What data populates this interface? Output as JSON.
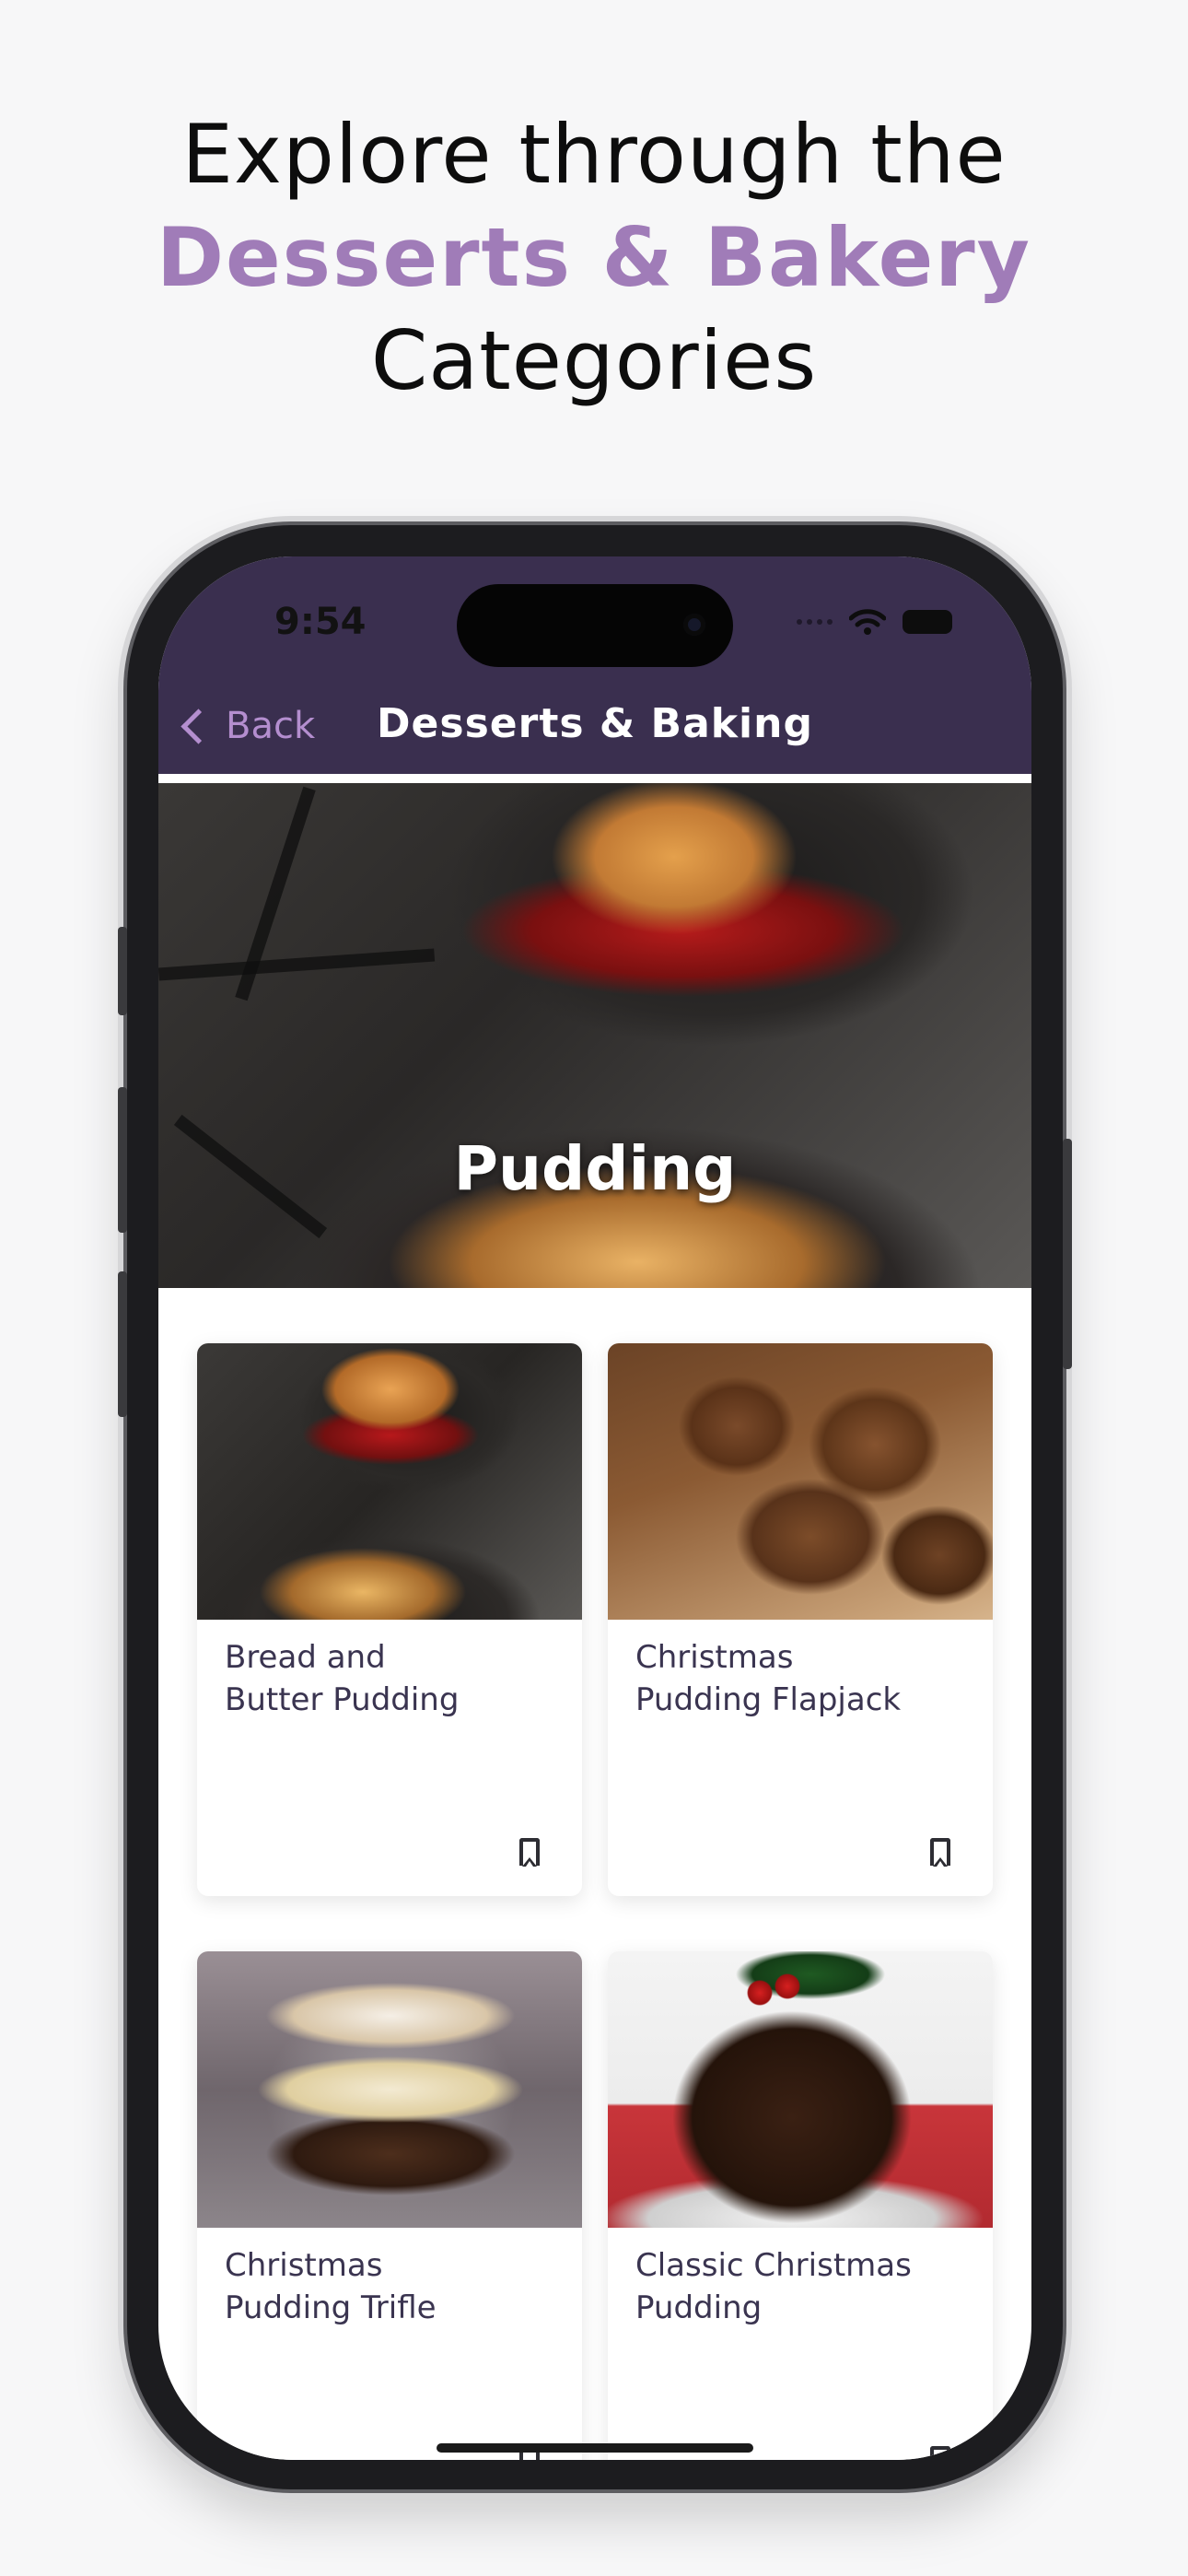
{
  "headline": {
    "line1": "Explore through the",
    "accent": "Desserts & Bakery",
    "line3": "Categories"
  },
  "status": {
    "time": "9:54"
  },
  "nav": {
    "back_label": "Back",
    "title": "Desserts & Baking"
  },
  "hero": {
    "title": "Pudding"
  },
  "recipes": [
    {
      "title": "Bread and\nButter Pudding",
      "image": "bread-and-butter-pudding"
    },
    {
      "title": "Christmas\nPudding Flapjack",
      "image": "christmas-pudding-flapjack"
    },
    {
      "title": "Christmas\nPudding Trifle",
      "image": "christmas-pudding-trifle"
    },
    {
      "title": "Classic Christmas\nPudding",
      "image": "classic-christmas-pudding"
    }
  ],
  "colors": {
    "accent": "#a07cb8",
    "nav_bar": "#3a2f4f",
    "back_link": "#b48ecf",
    "card_text": "#3a3450"
  },
  "icons": [
    "chevron-left-icon",
    "wifi-icon",
    "battery-icon",
    "bookmark-icon"
  ]
}
